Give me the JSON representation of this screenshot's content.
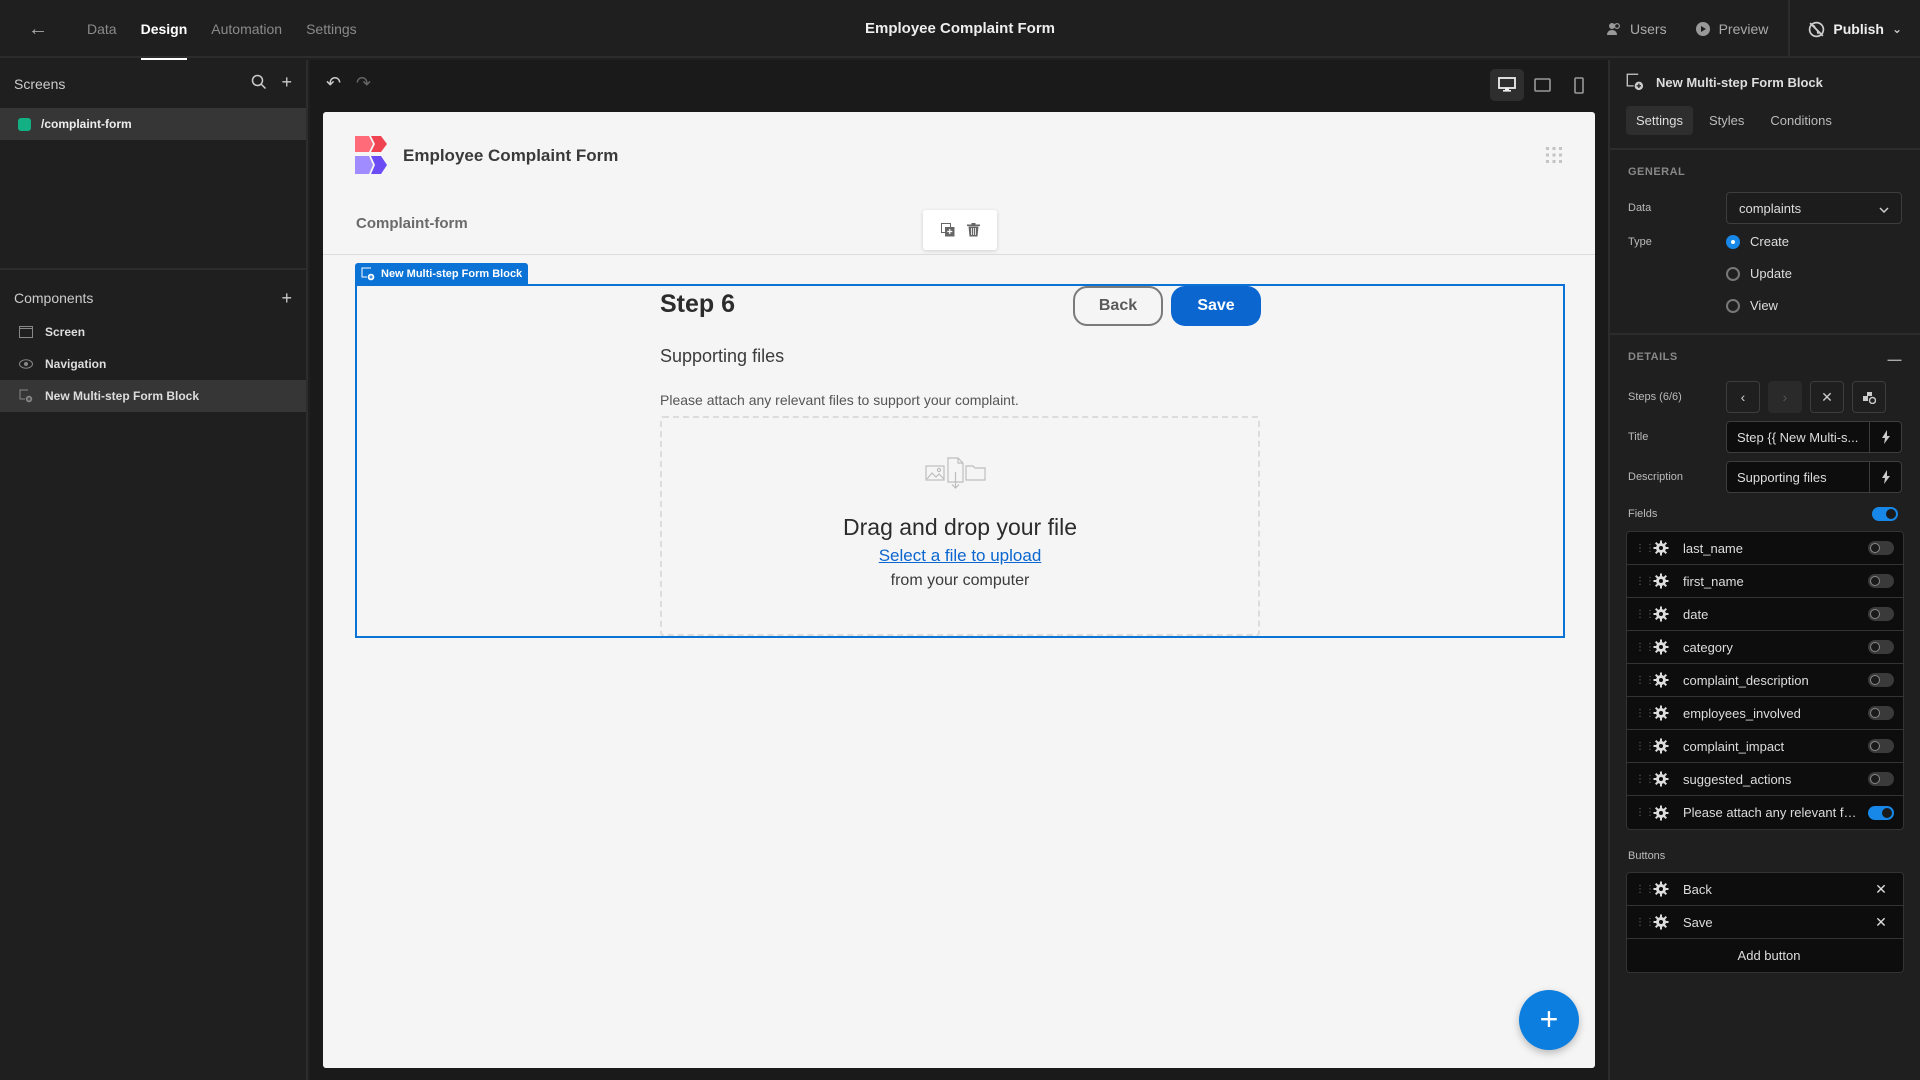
{
  "topbar": {
    "tabs": [
      {
        "label": "Data",
        "active": false
      },
      {
        "label": "Design",
        "active": true
      },
      {
        "label": "Automation",
        "active": false
      },
      {
        "label": "Settings",
        "active": false
      }
    ],
    "app_title": "Employee Complaint Form",
    "users_label": "Users",
    "preview_label": "Preview",
    "publish_label": "Publish"
  },
  "left_panel": {
    "screens_title": "Screens",
    "screens": [
      {
        "label": "/complaint-form",
        "color": "#12b083"
      }
    ],
    "components_title": "Components",
    "components": [
      {
        "label": "Screen",
        "icon": "screen-icon"
      },
      {
        "label": "Navigation",
        "icon": "eye-icon"
      },
      {
        "label": "New Multi-step Form Block",
        "icon": "form-block-icon",
        "selected": true
      }
    ]
  },
  "canvas": {
    "app_name": "Employee Complaint Form",
    "page_name": "Complaint-form",
    "block_label": "New Multi-step Form Block",
    "step_title": "Step 6",
    "back_label": "Back",
    "save_label": "Save",
    "step_description": "Supporting files",
    "field_label": "Please attach any relevant files to support your complaint.",
    "dropzone": {
      "title": "Drag and drop your file",
      "link": "Select a file to upload",
      "subtitle": "from your computer"
    },
    "accent": "#0b66cf"
  },
  "right_panel": {
    "component_title": "New Multi-step Form Block",
    "tabs": [
      {
        "label": "Settings",
        "active": true
      },
      {
        "label": "Styles",
        "active": false
      },
      {
        "label": "Conditions",
        "active": false
      }
    ],
    "general_title": "GENERAL",
    "data_label": "Data",
    "data_value": "complaints",
    "type_label": "Type",
    "type_options": [
      {
        "label": "Create",
        "selected": true
      },
      {
        "label": "Update",
        "selected": false
      },
      {
        "label": "View",
        "selected": false
      }
    ],
    "details_title": "DETAILS",
    "steps_label": "Steps (6/6)",
    "title_label": "Title",
    "title_value": "Step {{ New Multi-s...",
    "description_label": "Description",
    "description_value": "Supporting files",
    "fields_label": "Fields",
    "fields_enabled": true,
    "fields": [
      {
        "label": "last_name",
        "on": false
      },
      {
        "label": "first_name",
        "on": false
      },
      {
        "label": "date",
        "on": false
      },
      {
        "label": "category",
        "on": false
      },
      {
        "label": "complaint_description",
        "on": false
      },
      {
        "label": "employees_involved",
        "on": false
      },
      {
        "label": "complaint_impact",
        "on": false
      },
      {
        "label": "suggested_actions",
        "on": false
      },
      {
        "label": "Please attach any relevant fil...",
        "on": true
      }
    ],
    "buttons_label": "Buttons",
    "buttons": [
      {
        "label": "Back"
      },
      {
        "label": "Save"
      }
    ],
    "add_button_label": "Add button"
  }
}
